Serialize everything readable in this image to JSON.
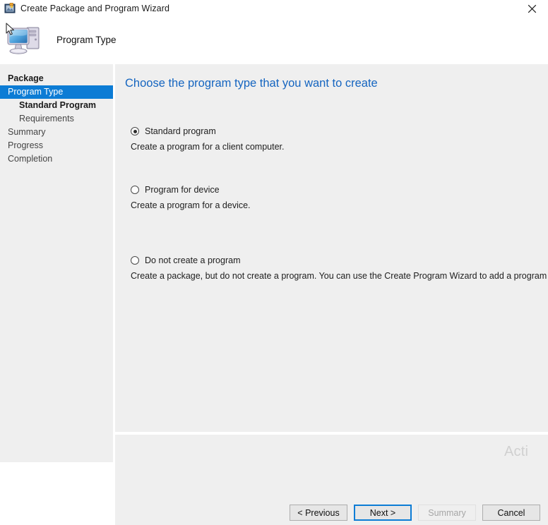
{
  "window": {
    "title": "Create Package and Program Wizard",
    "titlebar_icon": "package-wizard-icon",
    "close_icon": "close-icon",
    "accent_color": "#0c7cd5",
    "heading_color": "#1565c0",
    "surface_color": "#efefef"
  },
  "header": {
    "icon": "computer-icon",
    "cursor_icon": "mouse-cursor-icon",
    "title": "Program Type"
  },
  "sidebar": {
    "items": [
      {
        "label": "Package",
        "bold": true,
        "indent": false,
        "selected": false
      },
      {
        "label": "Program Type",
        "bold": false,
        "indent": false,
        "selected": true
      },
      {
        "label": "Standard Program",
        "bold": true,
        "indent": true,
        "selected": false
      },
      {
        "label": "Requirements",
        "bold": false,
        "indent": true,
        "selected": false
      },
      {
        "label": "Summary",
        "bold": false,
        "indent": false,
        "selected": false
      },
      {
        "label": "Progress",
        "bold": false,
        "indent": false,
        "selected": false
      },
      {
        "label": "Completion",
        "bold": false,
        "indent": false,
        "selected": false
      }
    ]
  },
  "content": {
    "heading": "Choose the program type that you want to create",
    "options": [
      {
        "label": "Standard program",
        "description": "Create a program for a client computer.",
        "checked": true
      },
      {
        "label": "Program for device",
        "description": "Create a program for a device.",
        "checked": false
      },
      {
        "label": "Do not create a program",
        "description": "Create a package, but do not create a program. You can use the Create Program Wizard to add a program later.",
        "checked": false
      }
    ]
  },
  "footer": {
    "buttons": [
      {
        "label": "< Previous",
        "state": "enabled"
      },
      {
        "label": "Next >",
        "state": "default"
      },
      {
        "label": "Summary",
        "state": "disabled"
      },
      {
        "label": "Cancel",
        "state": "enabled"
      }
    ]
  },
  "watermark": {
    "text": "Acti"
  }
}
